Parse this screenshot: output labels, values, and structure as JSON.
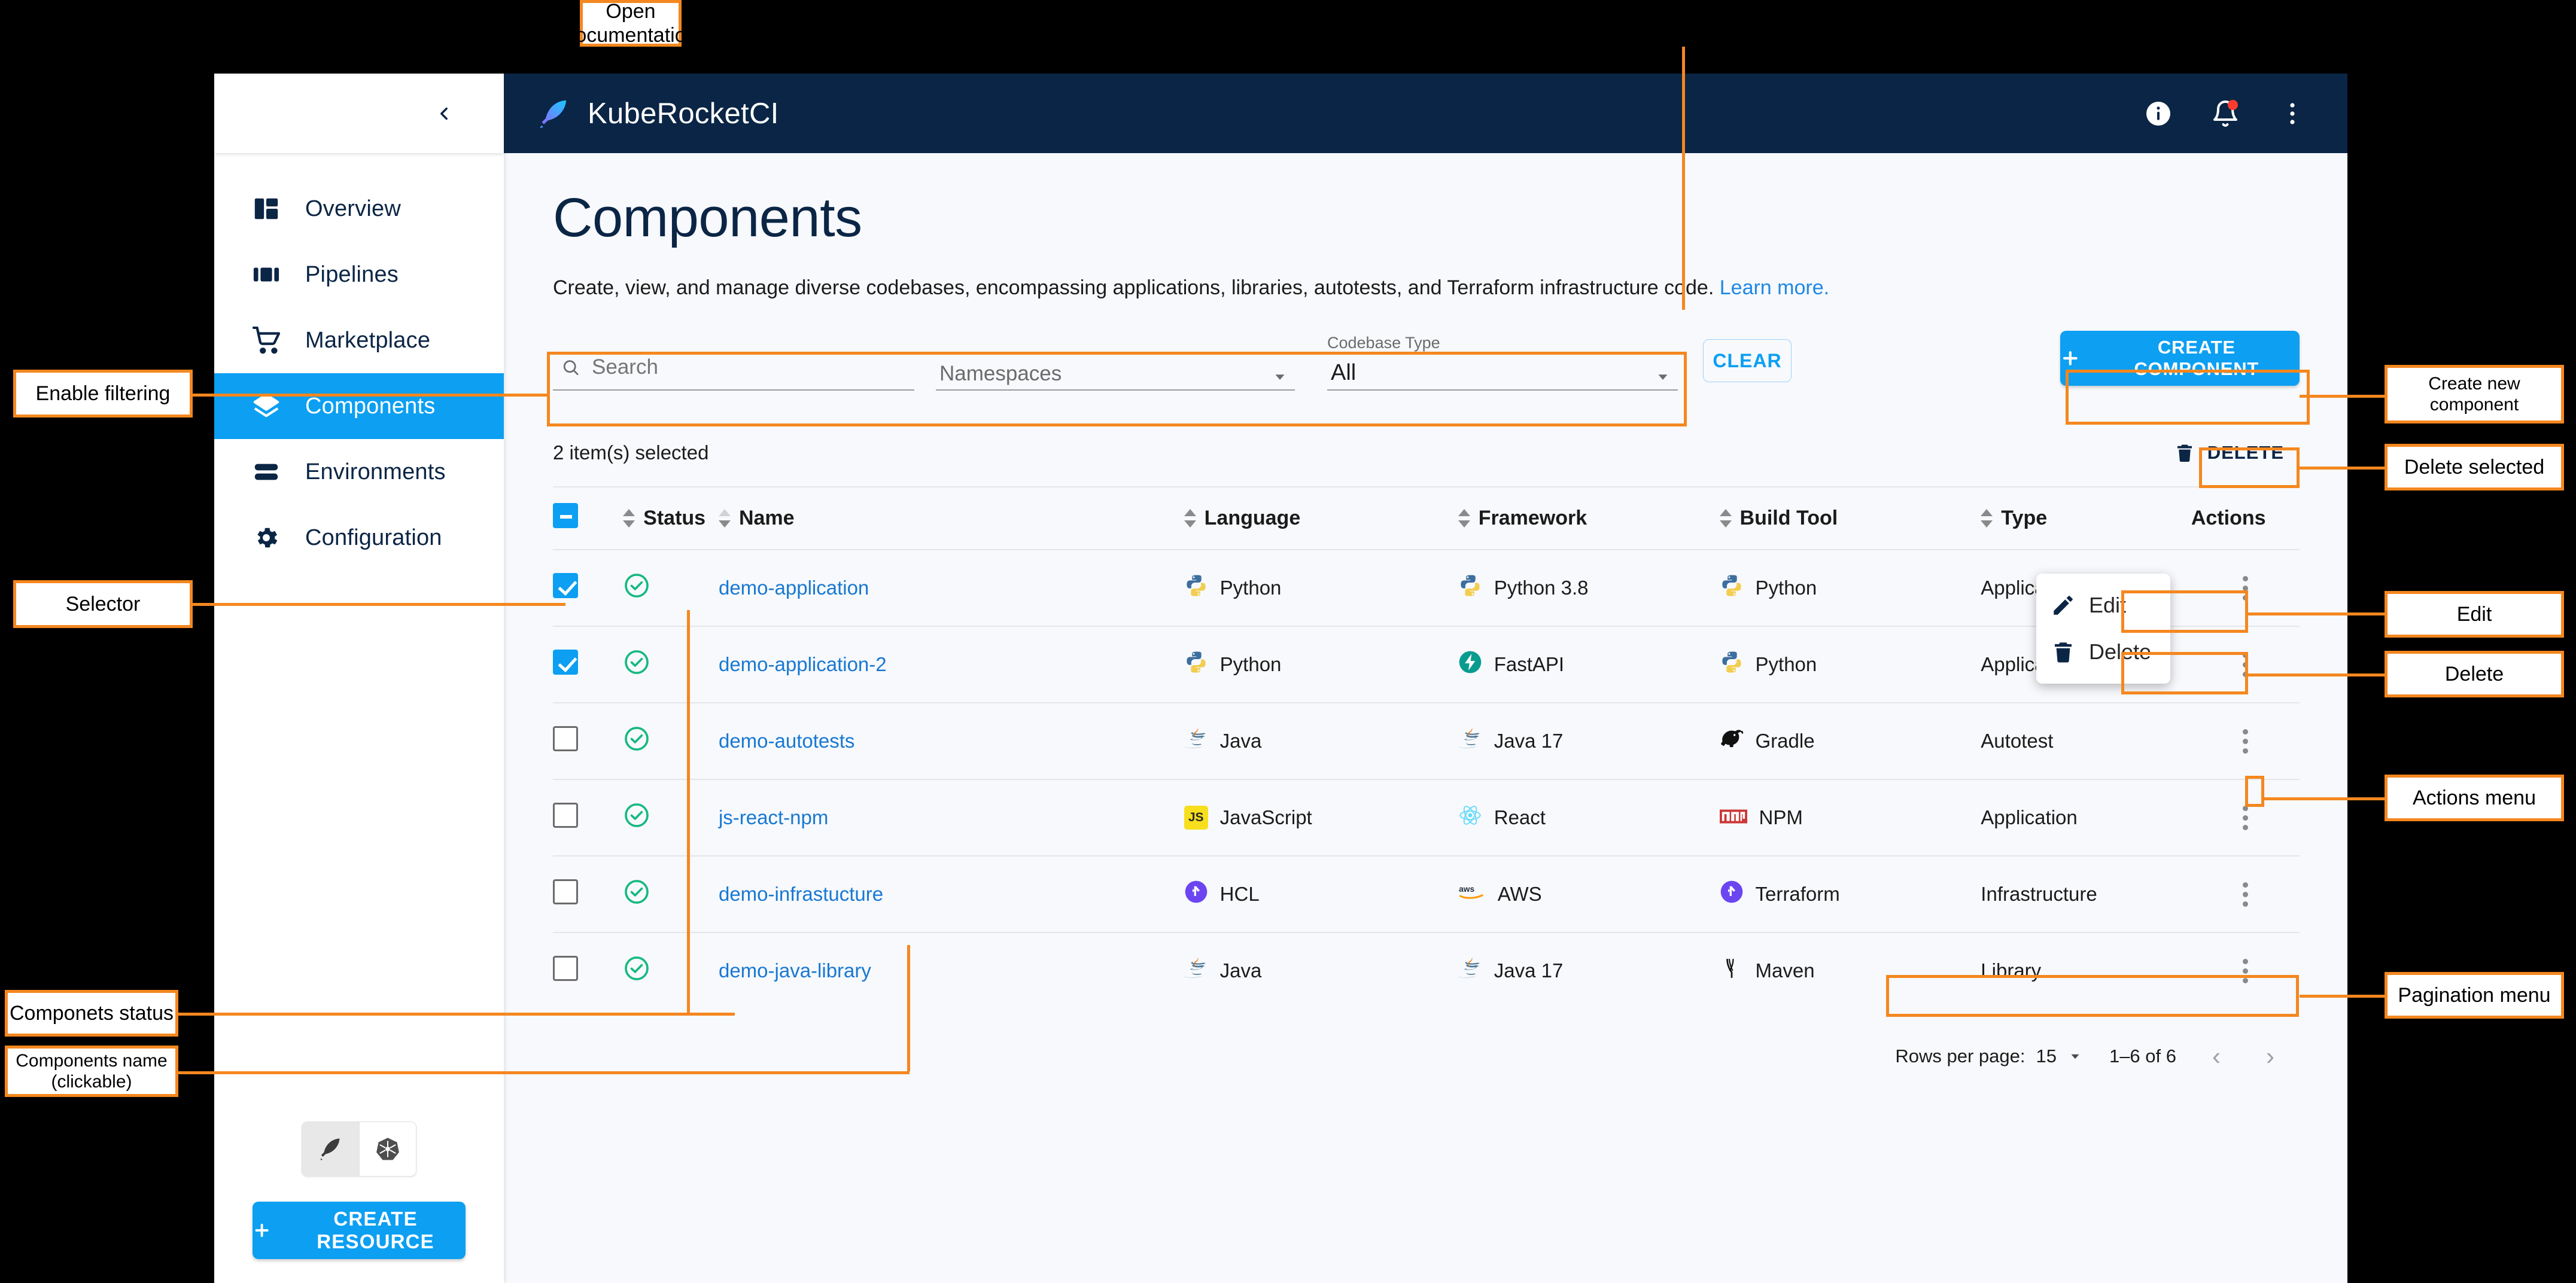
{
  "topbar": {
    "brand": "KubeRocketCI",
    "icons": [
      "info-icon",
      "notifications-icon",
      "overflow-menu-icon"
    ]
  },
  "sidebar": {
    "collapse_icon": "chevron-left-icon",
    "items": [
      {
        "label": "Overview",
        "icon": "dashboard-icon",
        "active": false
      },
      {
        "label": "Pipelines",
        "icon": "pipelines-icon",
        "active": false
      },
      {
        "label": "Marketplace",
        "icon": "cart-icon",
        "active": false
      },
      {
        "label": "Components",
        "icon": "layers-icon",
        "active": true
      },
      {
        "label": "Environments",
        "icon": "stack-icon",
        "active": false
      },
      {
        "label": "Configuration",
        "icon": "gear-icon",
        "active": false
      }
    ],
    "view_toggle": [
      {
        "icon": "kuberocket-feather-icon",
        "selected": true
      },
      {
        "icon": "kubernetes-helm-icon",
        "selected": false
      }
    ],
    "create_resource_label": "CREATE RESOURCE",
    "create_resource_icon": "plus-icon"
  },
  "page": {
    "title": "Components",
    "description": "Create, view, and manage diverse codebases, encompassing applications, libraries, autotests, and Terraform infrastructure code.",
    "learn_more": "Learn more."
  },
  "filters": {
    "search_placeholder": "Search",
    "search_value": "",
    "search_icon": "search-icon",
    "namespaces_label": "",
    "namespaces_value": "Namespaces",
    "codebase_type_label": "Codebase Type",
    "codebase_type_value": "All",
    "clear_label": "CLEAR",
    "create_component_label": "CREATE COMPONENT",
    "create_component_icon": "plus-icon"
  },
  "toolbar": {
    "selected_count_text": "2 item(s) selected",
    "delete_label": "DELETE",
    "delete_icon": "trash-icon"
  },
  "table": {
    "headers": [
      "",
      "Status",
      "Name",
      "Language",
      "Framework",
      "Build Tool",
      "Type",
      "Actions"
    ],
    "header_checkbox_state": "indeterminate",
    "rows": [
      {
        "checked": true,
        "status": "check-circle-icon",
        "name": "demo-application",
        "language": "Python",
        "language_icon": "python-icon",
        "framework": "Python 3.8",
        "framework_icon": "python-icon",
        "build_tool": "Python",
        "build_tool_icon": "python-icon",
        "type": "Application"
      },
      {
        "checked": true,
        "status": "check-circle-icon",
        "name": "demo-application-2",
        "language": "Python",
        "language_icon": "python-icon",
        "framework": "FastAPI",
        "framework_icon": "fastapi-icon",
        "build_tool": "Python",
        "build_tool_icon": "python-icon",
        "type": "Application"
      },
      {
        "checked": false,
        "status": "check-circle-icon",
        "name": "demo-autotests",
        "language": "Java",
        "language_icon": "java-icon",
        "framework": "Java 17",
        "framework_icon": "java-icon",
        "build_tool": "Gradle",
        "build_tool_icon": "gradle-icon",
        "type": "Autotest"
      },
      {
        "checked": false,
        "status": "check-circle-icon",
        "name": "js-react-npm",
        "language": "JavaScript",
        "language_icon": "javascript-icon",
        "framework": "React",
        "framework_icon": "react-icon",
        "build_tool": "NPM",
        "build_tool_icon": "npm-icon",
        "type": "Application"
      },
      {
        "checked": false,
        "status": "check-circle-icon",
        "name": "demo-infrastucture",
        "language": "HCL",
        "language_icon": "terraform-icon",
        "framework": "AWS",
        "framework_icon": "aws-icon",
        "build_tool": "Terraform",
        "build_tool_icon": "terraform-icon",
        "type": "Infrastructure"
      },
      {
        "checked": false,
        "status": "check-circle-icon",
        "name": "demo-java-library",
        "language": "Java",
        "language_icon": "java-icon",
        "framework": "Java 17",
        "framework_icon": "java-icon",
        "build_tool": "Maven",
        "build_tool_icon": "maven-icon",
        "type": "Library"
      }
    ]
  },
  "row_menu": {
    "edit_label": "Edit",
    "edit_icon": "pencil-icon",
    "delete_label": "Delete",
    "delete_icon": "trash-icon"
  },
  "pagination": {
    "rows_per_page_label": "Rows per page:",
    "rows_per_page_value": "15",
    "range_text": "1–6 of 6",
    "prev_icon": "chevron-left-icon",
    "next_icon": "chevron-right-icon"
  },
  "annotations": {
    "open_documentation": "Open documentation",
    "enable_filtering": "Enable filtering",
    "selector": "Selector",
    "components_status": "Componets status",
    "components_name": "Components name\n(clickable)",
    "create_new_component": "Create new\ncomponent",
    "delete_selected": "Delete selected",
    "edit": "Edit",
    "delete": "Delete",
    "actions_menu": "Actions menu",
    "pagination_menu": "Pagination menu"
  },
  "colors": {
    "accent": "#0c9ff2",
    "navy": "#0a2545",
    "annotation": "#f5871f",
    "link": "#1878d2",
    "status_ok": "#16b97f"
  }
}
